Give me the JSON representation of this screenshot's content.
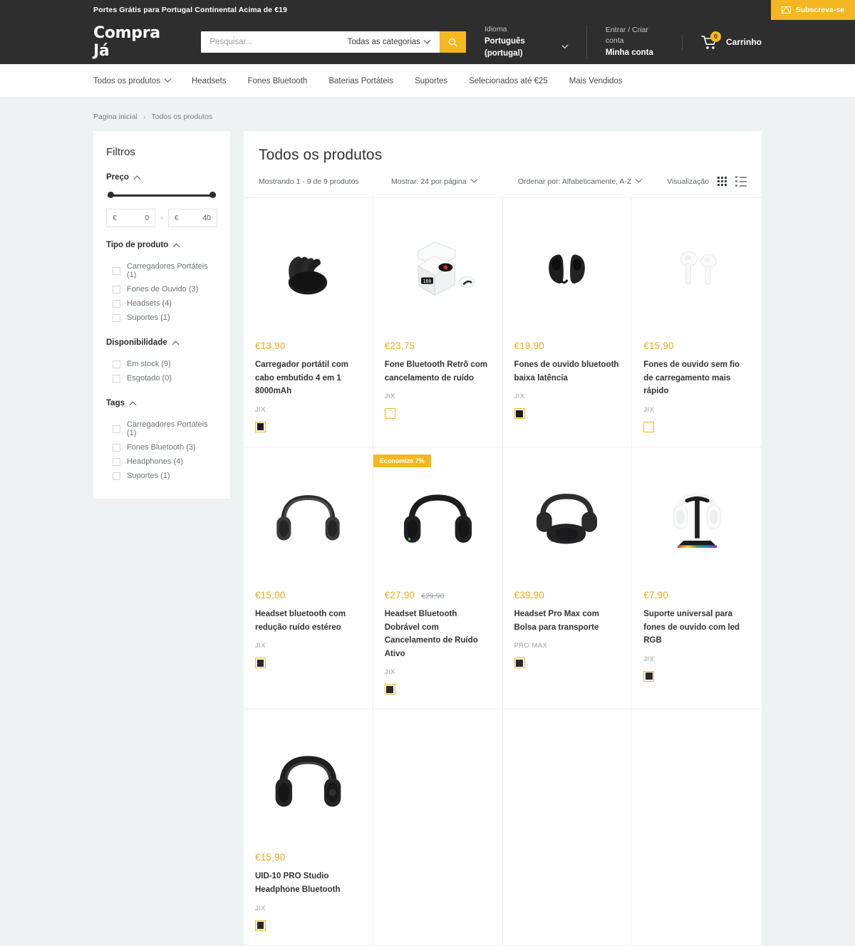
{
  "announcement": {
    "text": "Portes Grátis para Portugal Continental Acima de €19",
    "subscribe_label": "Subscreva-se",
    "icon": "mail-icon"
  },
  "header": {
    "logo": "Compra Já",
    "search": {
      "placeholder": "Pesquisar...",
      "value": "",
      "category": "Todas as categorias",
      "icon": "search-icon"
    },
    "language": {
      "label": "Idioma",
      "value": "Português (portugal)"
    },
    "account": {
      "label": "Entrar / Criar conta",
      "value": "Minha conta"
    },
    "cart": {
      "label": "Carrinho",
      "count": "0",
      "icon": "cart-icon"
    }
  },
  "nav": {
    "items": [
      {
        "label": "Todos os produtos",
        "has_chevron": true
      },
      {
        "label": "Headsets",
        "has_chevron": false
      },
      {
        "label": "Fones Bluetooth",
        "has_chevron": false
      },
      {
        "label": "Baterias Portáteis",
        "has_chevron": false
      },
      {
        "label": "Suportes",
        "has_chevron": false
      },
      {
        "label": "Selecionados até €25",
        "has_chevron": false
      },
      {
        "label": "Mais Vendidos",
        "has_chevron": false
      }
    ]
  },
  "breadcrumb": {
    "home": "Pagina inicial",
    "separator": "›",
    "current": "Todos os produtos"
  },
  "sidebar": {
    "title": "Filtros",
    "price": {
      "title": "Preço",
      "currency": "€",
      "min": "0",
      "max": "40",
      "dash": "-"
    },
    "groups": [
      {
        "title": "Tipo de produto",
        "options": [
          {
            "label": "Carregadores Portáteis (1)",
            "checked": false
          },
          {
            "label": "Fones de Ouvido (3)",
            "checked": false
          },
          {
            "label": "Headsets (4)",
            "checked": false
          },
          {
            "label": "Suportes (1)",
            "checked": false
          }
        ]
      },
      {
        "title": "Disponibilidade",
        "options": [
          {
            "label": "Em stock (9)",
            "checked": false
          },
          {
            "label": "Esgotado (0)",
            "checked": false
          }
        ]
      },
      {
        "title": "Tags",
        "options": [
          {
            "label": "Carregadores Portáteis (1)",
            "checked": false
          },
          {
            "label": "Fones Bluetooth (3)",
            "checked": false
          },
          {
            "label": "Headphones (4)",
            "checked": false
          },
          {
            "label": "Suportes (1)",
            "checked": false
          }
        ]
      }
    ]
  },
  "main": {
    "title": "Todos os produtos",
    "showing": "Mostrando 1 - 9 de 9 produtos",
    "per_page": "Mostrar: 24 por página",
    "sort": "Ordenar por: Alfabeticamente, A-Z",
    "view_label": "Visualização"
  },
  "products": [
    {
      "price": "€13,90",
      "price_old": "",
      "badge": "",
      "name": "Carregador portátil com cabo embutido 4 em 1 8000mAh",
      "vendor": "JIX",
      "swatch": "#1c1c1c",
      "image": "power-bank"
    },
    {
      "price": "€23,75",
      "price_old": "",
      "badge": "",
      "name": "Fone Bluetooth Retrô com cancelamento de ruído",
      "vendor": "JIX",
      "swatch": "#ffffff",
      "image": "earbuds-case"
    },
    {
      "price": "€19,90",
      "price_old": "",
      "badge": "",
      "name": "Fones de ouvido bluetooth baixa latência",
      "vendor": "JIX",
      "swatch": "#1c1c1c",
      "image": "earbuds-black"
    },
    {
      "price": "€15,90",
      "price_old": "",
      "badge": "",
      "name": "Fones de ouvido sem fio de carregamento mais rápido",
      "vendor": "JIX",
      "swatch": "#ffffff",
      "image": "airpods-white"
    },
    {
      "price": "€15,00",
      "price_old": "",
      "badge": "",
      "name": "Headset bluetooth com redução ruído estéreo",
      "vendor": "JIX",
      "swatch": "#2a2a2a",
      "image": "headset-grey"
    },
    {
      "price": "€27,90",
      "price_old": "€29,90",
      "badge": "Economize 7%",
      "name": "Headset Bluetooth Dobrável com Cancelamento de Ruído Ativo",
      "vendor": "JIX",
      "swatch": "#2a2a2a",
      "image": "headset-black"
    },
    {
      "price": "€39,90",
      "price_old": "",
      "badge": "",
      "name": "Headset Pro Max com Bolsa para transporte",
      "vendor": "PRO MAX",
      "swatch": "#2a2a2a",
      "image": "headset-bag"
    },
    {
      "price": "€7,90",
      "price_old": "",
      "badge": "",
      "name": "Suporte universal para fones de ouvido com led RGB",
      "vendor": "JIX",
      "swatch": "#2a2a2a",
      "image": "stand-rgb"
    },
    {
      "price": "€15,90",
      "price_old": "",
      "badge": "",
      "name": "UID-10 PRO Studio Headphone Bluetooth",
      "vendor": "JIX",
      "swatch": "#2a2a2a",
      "image": "headphone-studio"
    }
  ],
  "colors": {
    "accent": "#f5b721",
    "price": "#f0a81e",
    "dark": "#2e2e2e",
    "page_bg": "#eef2f3"
  }
}
